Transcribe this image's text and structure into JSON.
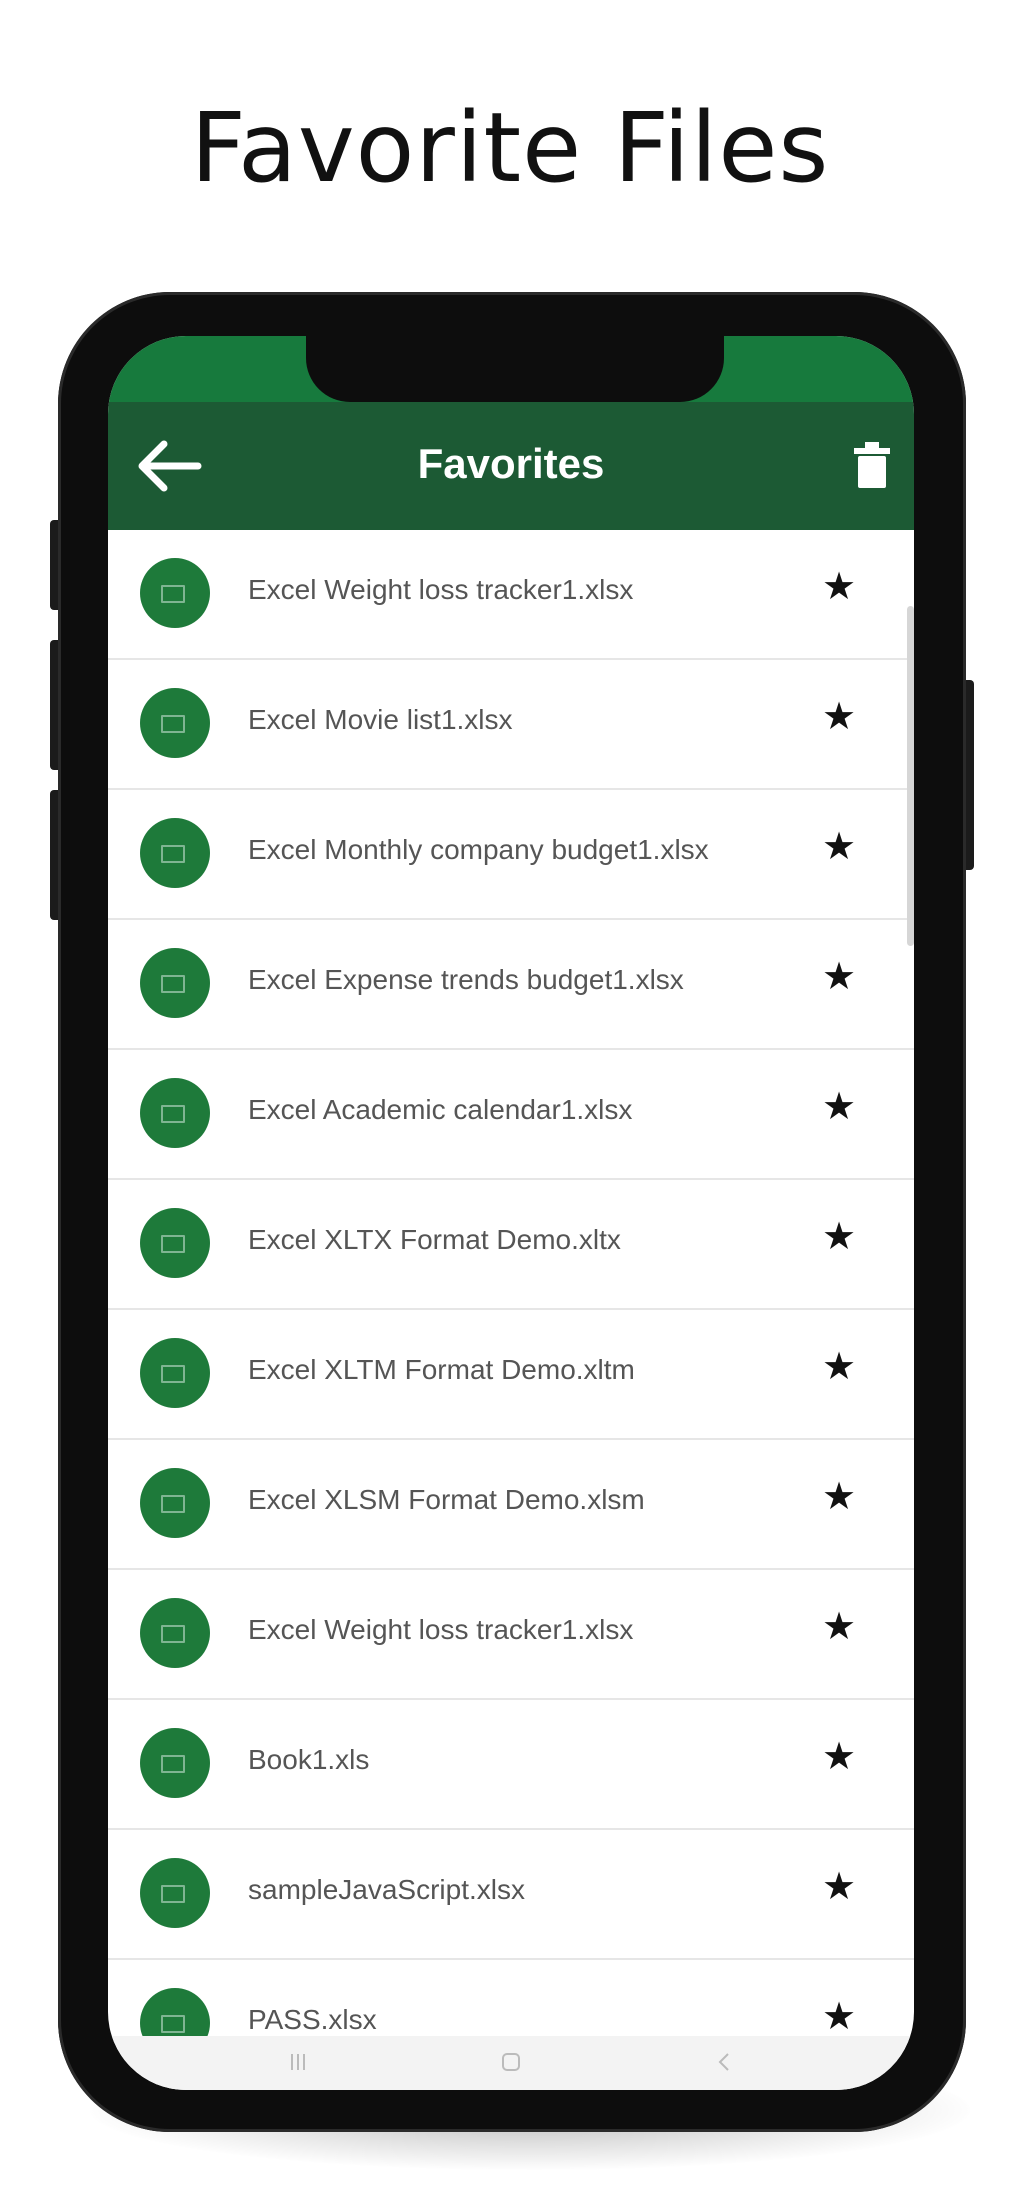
{
  "headline": "Favorite Files",
  "appbar": {
    "title": "Favorites",
    "back_icon": "arrow-left-icon",
    "delete_icon": "trash-icon",
    "color": "#1c5a34"
  },
  "status_bar_color": "#177a3d",
  "files": [
    {
      "name": "Excel Weight loss tracker1.xlsx"
    },
    {
      "name": "Excel Movie list1.xlsx"
    },
    {
      "name": "Excel Monthly company budget1.xlsx"
    },
    {
      "name": "Excel Expense trends budget1.xlsx"
    },
    {
      "name": "Excel Academic calendar1.xlsx"
    },
    {
      "name": "Excel XLTX Format Demo.xltx"
    },
    {
      "name": "Excel XLTM Format Demo.xltm"
    },
    {
      "name": "Excel XLSM Format Demo.xlsm"
    },
    {
      "name": "Excel Weight loss tracker1.xlsx"
    },
    {
      "name": "Book1.xls"
    },
    {
      "name": "sampleJavaScript.xlsx"
    },
    {
      "name": "PASS.xlsx"
    }
  ],
  "file_icon": "excel-file-icon",
  "favorite_icon": "star-icon",
  "icon_color": "#1e7a3a"
}
